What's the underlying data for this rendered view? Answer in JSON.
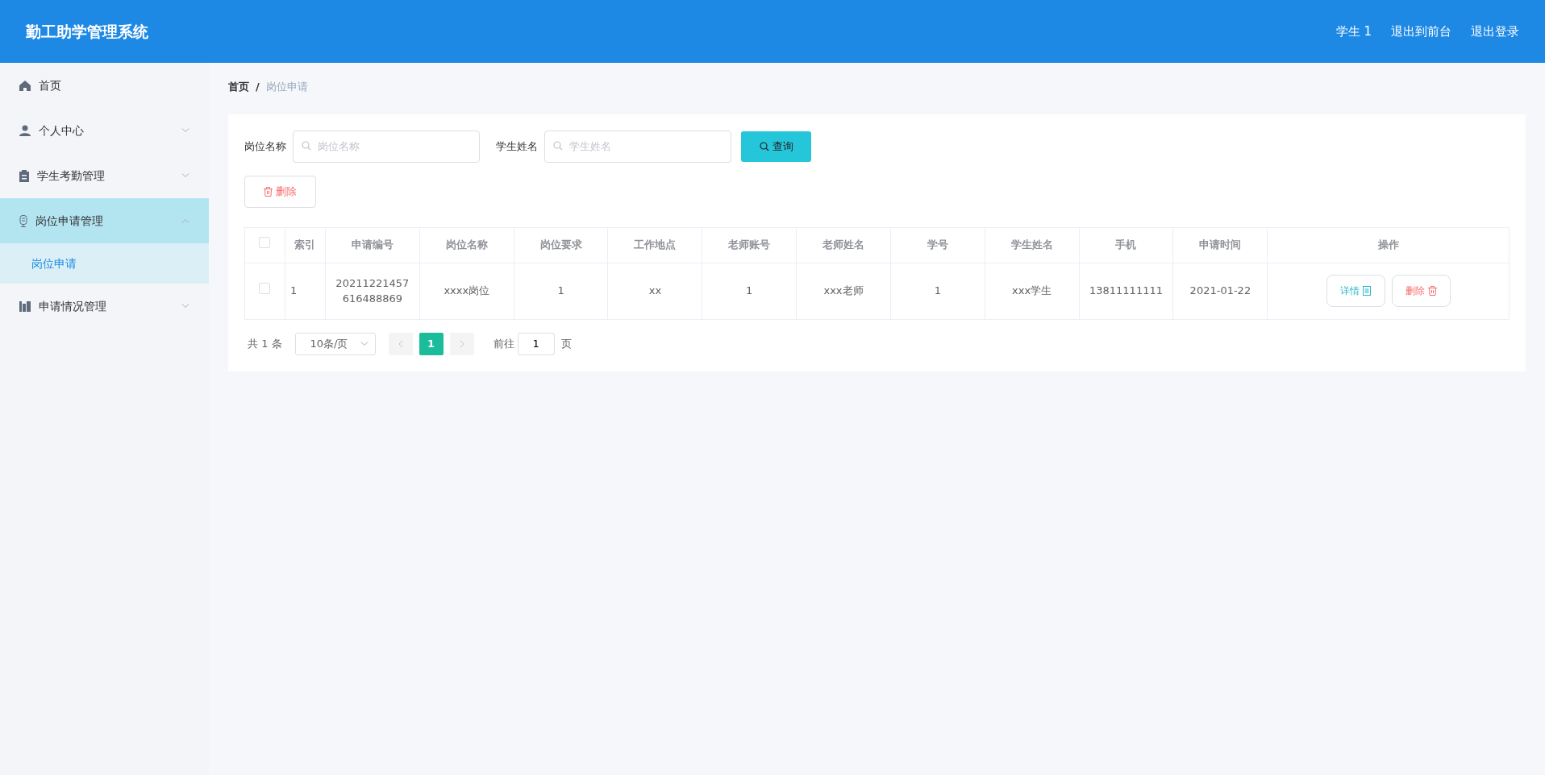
{
  "header": {
    "title": "勤工助学管理系统",
    "links": [
      "学生 1",
      "退出到前台",
      "退出登录"
    ]
  },
  "sidebar": {
    "items": [
      {
        "label": "首页",
        "kind": "home"
      },
      {
        "label": "个人中心",
        "kind": "user",
        "expanded": false
      },
      {
        "label": "学生考勤管理",
        "kind": "clipboard",
        "expanded": false
      },
      {
        "label": "岗位申请管理",
        "kind": "mic",
        "expanded": true,
        "children": [
          {
            "label": "岗位申请",
            "selected": true
          }
        ]
      },
      {
        "label": "申请情况管理",
        "kind": "chart",
        "expanded": false
      }
    ]
  },
  "breadcrumb": [
    "首页",
    "岗位申请"
  ],
  "breadcrumb_separator": "/",
  "filters": [
    {
      "label": "岗位名称",
      "placeholder": "岗位名称"
    },
    {
      "label": "学生姓名",
      "placeholder": "学生姓名"
    }
  ],
  "search_button": "查询",
  "delete_button": "删除",
  "table": {
    "header_checked": false,
    "columns": [
      "索引",
      "申请编号",
      "岗位名称",
      "岗位要求",
      "工作地点",
      "老师账号",
      "老师姓名",
      "学号",
      "学生姓名",
      "手机",
      "申请时间",
      "操作"
    ],
    "rows": [
      {
        "checked": false,
        "cells": [
          "1",
          "20211221457616488869",
          "xxxx岗位",
          "1",
          "xx",
          "1",
          "xxx老师",
          "1",
          "xxx学生",
          "13811111111",
          "2021-01-22"
        ],
        "actions": [
          "详情",
          "删除"
        ]
      }
    ]
  },
  "pagination": {
    "total": "共 1 条",
    "page_size": "10条/页",
    "pages": [
      {
        "label": "1",
        "selected": true
      }
    ],
    "goto_label": "前往",
    "goto_value": "1",
    "goto_suffix": "页"
  }
}
